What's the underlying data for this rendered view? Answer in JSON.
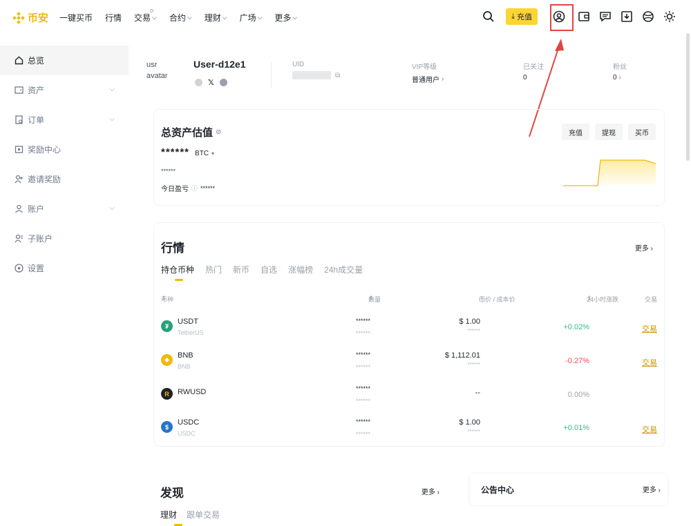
{
  "brand": {
    "name": "币安",
    "color": "#F0B90B"
  },
  "nav": {
    "items": [
      {
        "label": "一键买币",
        "has_menu": false
      },
      {
        "label": "行情",
        "has_menu": false
      },
      {
        "label": "交易",
        "has_menu": true
      },
      {
        "label": "合约",
        "has_menu": true
      },
      {
        "label": "理财",
        "has_menu": true
      },
      {
        "label": "广场",
        "has_menu": true
      },
      {
        "label": "更多",
        "has_menu": true
      }
    ],
    "deposit_label": "充值"
  },
  "sidebar": {
    "items": [
      {
        "label": "总览",
        "icon": "home-icon",
        "expandable": false,
        "active": true
      },
      {
        "label": "资产",
        "icon": "wallet-icon",
        "expandable": true,
        "active": false
      },
      {
        "label": "订单",
        "icon": "order-icon",
        "expandable": true,
        "active": false
      },
      {
        "label": "奖励中心",
        "icon": "reward-icon",
        "expandable": false,
        "active": false
      },
      {
        "label": "邀请奖励",
        "icon": "invite-icon",
        "expandable": false,
        "active": false
      },
      {
        "label": "账户",
        "icon": "user-icon",
        "expandable": true,
        "active": false
      },
      {
        "label": "子账户",
        "icon": "subaccount-icon",
        "expandable": false,
        "active": false
      },
      {
        "label": "设置",
        "icon": "settings-icon",
        "expandable": false,
        "active": false
      }
    ]
  },
  "profile": {
    "avatar_alt": "usr avatar",
    "username": "User-d12e1",
    "uid_label": "UID",
    "vip_label": "VIP等级",
    "vip_value": "普通用户",
    "following_label": "已关注",
    "following_value": "0",
    "followers_label": "粉丝",
    "followers_value": "0"
  },
  "assets": {
    "title": "总资产估值",
    "value": "******",
    "currency": "BTC",
    "sub_value": "******",
    "pnl_label": "今日盈亏",
    "pnl_value": "******",
    "actions": [
      "充值",
      "提现",
      "买币"
    ]
  },
  "market": {
    "title": "行情",
    "more": "更多",
    "tabs": [
      "持仓币种",
      "热门",
      "新币",
      "自选",
      "涨幅榜",
      "24h成交量"
    ],
    "headers": {
      "coin": "币种",
      "amount": "数量",
      "price": "币价 / 成本价",
      "change": "24小时涨跌",
      "trade": "交易"
    },
    "rows": [
      {
        "symbol": "USDT",
        "name": "TetherUS",
        "amount": "******",
        "amount2": "******",
        "price": "$ 1.00",
        "cost": "******",
        "change": "+0.02%",
        "trend": "up",
        "trade": "交易",
        "icon_color": "#26A17B"
      },
      {
        "symbol": "BNB",
        "name": "BNB",
        "amount": "******",
        "amount2": "******",
        "price": "$ 1,112.01",
        "cost": "******",
        "change": "-0.27%",
        "trend": "down",
        "trade": "交易",
        "icon_color": "#F0B90B"
      },
      {
        "symbol": "RWUSD",
        "name": "",
        "amount": "******",
        "amount2": "******",
        "price": "--",
        "cost": "",
        "change": "0.00%",
        "trend": "flat",
        "trade": "",
        "icon_color": "#1e2329"
      },
      {
        "symbol": "USDC",
        "name": "USDC",
        "amount": "******",
        "amount2": "******",
        "price": "$ 1.00",
        "cost": "******",
        "change": "+0.01%",
        "trend": "up",
        "trade": "交易",
        "icon_color": "#2775CA"
      }
    ]
  },
  "discover": {
    "title": "发现",
    "more": "更多",
    "tabs": [
      "理财",
      "跟单交易"
    ]
  },
  "notice": {
    "title": "公告中心",
    "more": "更多"
  }
}
